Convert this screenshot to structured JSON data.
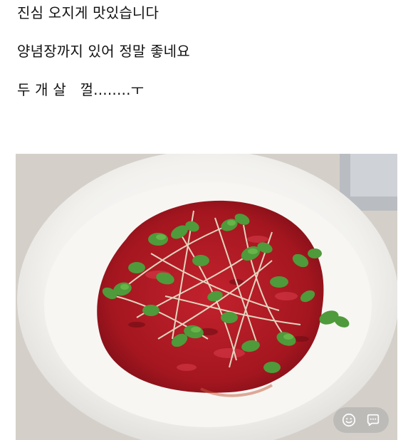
{
  "post": {
    "lines": [
      "진심 오지게 맛있습니다",
      "양념장까지 있어 정말 좋네요",
      "두 개 살   껄........ㅜ"
    ]
  },
  "photo": {
    "subject": "yukhoe-with-sprouts",
    "colors": {
      "counter": "#d6d2cb",
      "bowl": "#f4f3f0",
      "beef": "#b3202a",
      "sprouts": "#4f9a3a"
    }
  },
  "overlay": {
    "icons": [
      "smile-icon",
      "chat-bubble-icon"
    ]
  }
}
